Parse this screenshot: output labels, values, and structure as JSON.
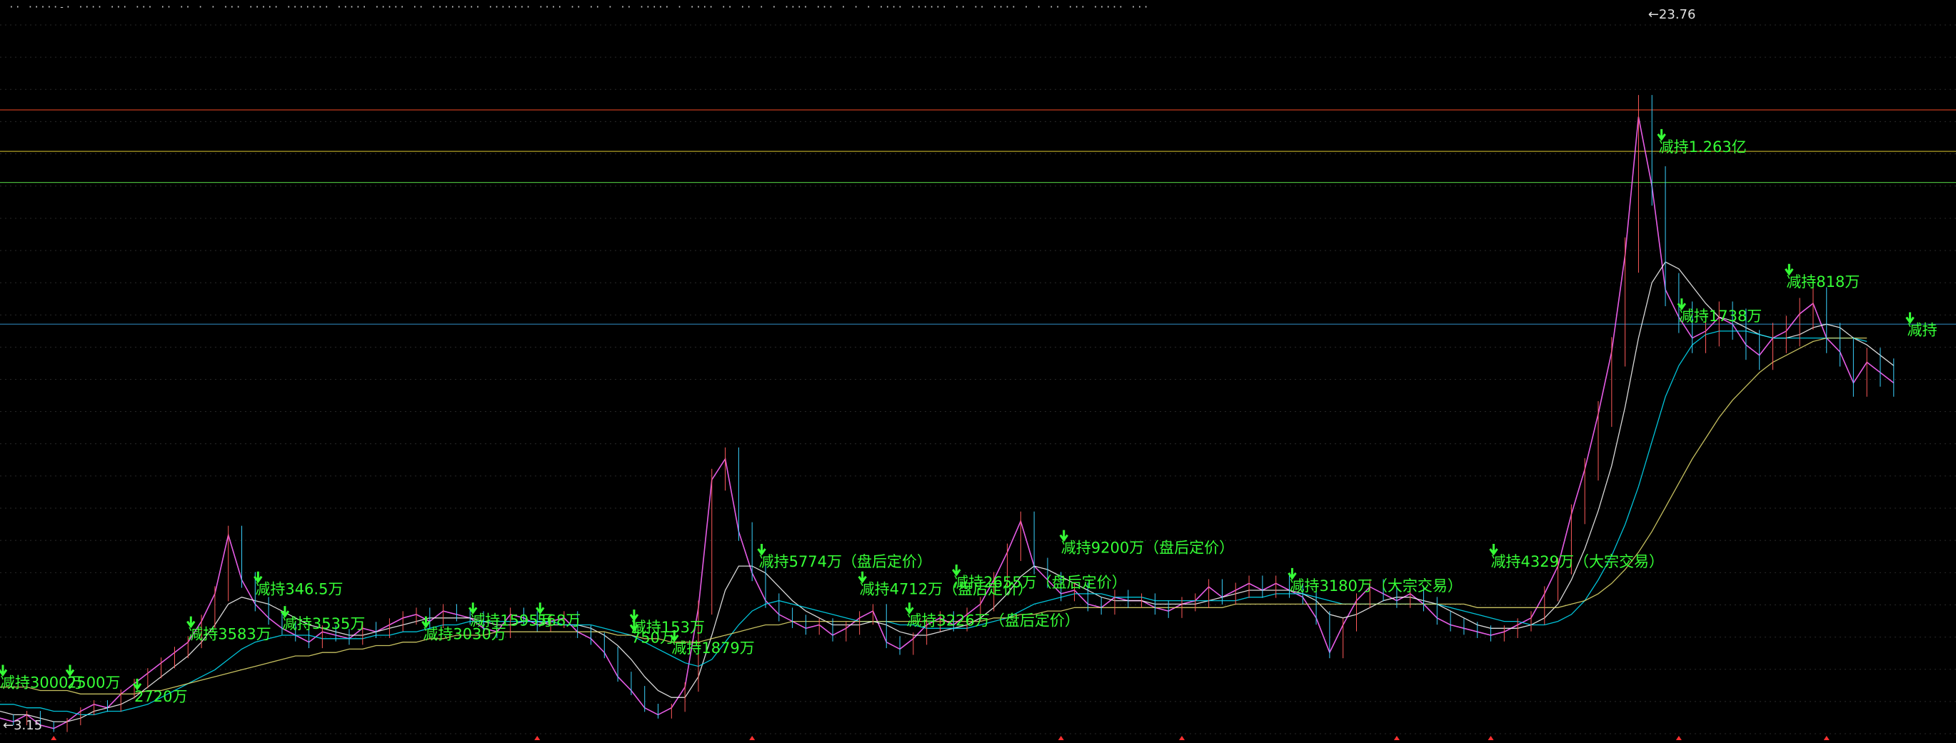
{
  "header": {
    "title": "·· ·····-· ···· ··· ··· ·· ·· · · ··· ····· ·······   ····· ·····   ··   ········ ·······  ···· ·· ·· · ·· ····· · ···· ·· ·· · · ···· ···  ·  · · ···· ······ ·· ·· ····  · ·  ·· ··· ····· ···"
  },
  "chart_data": {
    "type": "line",
    "title": "",
    "xlabel": "",
    "ylabel": "",
    "ylim": [
      3.15,
      23.76
    ],
    "grid": true,
    "x": [
      0,
      2,
      4,
      6,
      8,
      10,
      12,
      14,
      16,
      18,
      20,
      22,
      24,
      26,
      28,
      30,
      32,
      34,
      36,
      38,
      40,
      42,
      44,
      46,
      48,
      50,
      52,
      54,
      56,
      58,
      60,
      62,
      64,
      66,
      68,
      70,
      72,
      74,
      76,
      78,
      80,
      82,
      84,
      86,
      88,
      90,
      92,
      94,
      96,
      98,
      100,
      102,
      104,
      106,
      108,
      110,
      112,
      114,
      116,
      118,
      120,
      122,
      124,
      126,
      128,
      130,
      132,
      134,
      136,
      138,
      140,
      142,
      144,
      146,
      148,
      150,
      152,
      154,
      156,
      158,
      160,
      162,
      164,
      166,
      168,
      170,
      172,
      174,
      176,
      178,
      180,
      182,
      184,
      186,
      188,
      190,
      192,
      194,
      196,
      198,
      200,
      202,
      204,
      206,
      208,
      210,
      212,
      214,
      216,
      218,
      220,
      222,
      224,
      226,
      228,
      230,
      232,
      234,
      236,
      238,
      240,
      242,
      244,
      246,
      248,
      250,
      252,
      254,
      256,
      258,
      260,
      262,
      264,
      266,
      268,
      270,
      272,
      274,
      276,
      278,
      280,
      282,
      284,
      286,
      288,
      290
    ],
    "series": [
      {
        "values": [
          3.6,
          3.5,
          3.7,
          3.4,
          3.3,
          3.5,
          3.8,
          4.0,
          3.9,
          4.3,
          4.6,
          4.9,
          5.2,
          5.5,
          5.8,
          6.4,
          7.2,
          8.9,
          7.6,
          6.9,
          6.5,
          6.2,
          6.0,
          5.8,
          6.1,
          6.0,
          5.9,
          6.2,
          6.1,
          6.3,
          6.5,
          6.6,
          6.4,
          6.7,
          6.6,
          6.5,
          6.2,
          6.1,
          6.6,
          6.5,
          6.3,
          6.4,
          6.5,
          6.1,
          5.9,
          5.5,
          4.8,
          4.4,
          3.9,
          3.7,
          3.9,
          4.5,
          6.8,
          10.5,
          11.1,
          9.0,
          7.8,
          7.0,
          6.6,
          6.4,
          6.2,
          6.3,
          6.0,
          6.2,
          6.5,
          6.7,
          5.8,
          5.6,
          5.9,
          6.3,
          6.5,
          6.3,
          6.6,
          6.9,
          7.6,
          8.4,
          9.3,
          8.0,
          7.6,
          7.2,
          7.3,
          6.9,
          6.8,
          7.1,
          7.0,
          7.0,
          6.8,
          6.7,
          6.9,
          7.0,
          7.4,
          7.1,
          7.3,
          7.5,
          7.3,
          7.5,
          7.3,
          7.1,
          6.5,
          5.5,
          6.3,
          7.0,
          7.4,
          7.2,
          7.0,
          7.2,
          6.9,
          6.5,
          6.3,
          6.2,
          6.1,
          6.0,
          6.1,
          6.3,
          6.5,
          7.2,
          8.0,
          9.5,
          10.8,
          12.4,
          14.2,
          17.0,
          21.0,
          19.0,
          16.0,
          15.2,
          14.6,
          14.8,
          15.2,
          15.0,
          14.4,
          14.1,
          14.6,
          14.8,
          15.3,
          15.6,
          14.6,
          14.2,
          13.3,
          13.9,
          13.6,
          13.3
        ]
      },
      {
        "values": [
          3.8,
          3.7,
          3.7,
          3.6,
          3.5,
          3.5,
          3.6,
          3.8,
          3.9,
          4.0,
          4.2,
          4.5,
          4.8,
          5.1,
          5.4,
          5.8,
          6.3,
          6.9,
          7.1,
          7.0,
          6.9,
          6.7,
          6.5,
          6.3,
          6.2,
          6.1,
          6.0,
          6.0,
          6.1,
          6.2,
          6.3,
          6.4,
          6.5,
          6.5,
          6.5,
          6.5,
          6.4,
          6.3,
          6.3,
          6.4,
          6.4,
          6.3,
          6.3,
          6.3,
          6.2,
          6.0,
          5.7,
          5.3,
          4.8,
          4.4,
          4.2,
          4.2,
          4.8,
          6.0,
          7.3,
          8.0,
          8.0,
          7.8,
          7.4,
          7.0,
          6.7,
          6.5,
          6.3,
          6.3,
          6.3,
          6.4,
          6.3,
          6.1,
          6.0,
          6.0,
          6.1,
          6.2,
          6.3,
          6.5,
          6.8,
          7.2,
          7.7,
          8.0,
          7.9,
          7.7,
          7.5,
          7.3,
          7.1,
          7.0,
          7.0,
          7.0,
          6.9,
          6.9,
          6.9,
          6.9,
          7.0,
          7.1,
          7.2,
          7.3,
          7.3,
          7.3,
          7.3,
          7.2,
          7.0,
          6.6,
          6.5,
          6.6,
          6.8,
          7.0,
          7.1,
          7.1,
          7.0,
          6.9,
          6.7,
          6.5,
          6.3,
          6.2,
          6.2,
          6.2,
          6.3,
          6.5,
          6.9,
          7.6,
          8.5,
          9.6,
          10.9,
          12.6,
          14.6,
          16.2,
          16.8,
          16.6,
          16.1,
          15.6,
          15.2,
          15.1,
          14.9,
          14.7,
          14.6,
          14.6,
          14.7,
          14.9,
          15.0,
          14.9,
          14.6,
          14.4,
          14.1,
          13.8
        ]
      },
      {
        "values": [
          4.0,
          4.0,
          3.9,
          3.9,
          3.8,
          3.8,
          3.7,
          3.7,
          3.8,
          3.8,
          3.9,
          4.0,
          4.2,
          4.4,
          4.6,
          4.8,
          5.0,
          5.3,
          5.6,
          5.8,
          5.9,
          6.0,
          6.0,
          6.0,
          5.9,
          5.9,
          5.9,
          5.9,
          6.0,
          6.0,
          6.1,
          6.1,
          6.2,
          6.3,
          6.3,
          6.4,
          6.4,
          6.4,
          6.4,
          6.4,
          6.4,
          6.4,
          6.3,
          6.3,
          6.3,
          6.2,
          6.1,
          6.0,
          5.8,
          5.6,
          5.4,
          5.2,
          5.1,
          5.3,
          5.8,
          6.3,
          6.7,
          6.9,
          7.0,
          6.9,
          6.8,
          6.7,
          6.6,
          6.5,
          6.4,
          6.4,
          6.4,
          6.3,
          6.3,
          6.2,
          6.2,
          6.2,
          6.2,
          6.3,
          6.4,
          6.5,
          6.7,
          6.9,
          7.0,
          7.1,
          7.2,
          7.2,
          7.2,
          7.1,
          7.1,
          7.1,
          7.0,
          7.0,
          7.0,
          7.0,
          7.0,
          7.0,
          7.0,
          7.1,
          7.1,
          7.2,
          7.2,
          7.2,
          7.1,
          7.0,
          6.9,
          6.9,
          6.9,
          6.9,
          6.9,
          6.9,
          6.9,
          6.9,
          6.8,
          6.7,
          6.6,
          6.5,
          6.4,
          6.4,
          6.3,
          6.3,
          6.4,
          6.6,
          7.0,
          7.6,
          8.3,
          9.2,
          10.3,
          11.6,
          12.9,
          13.8,
          14.4,
          14.7,
          14.8,
          14.8,
          14.8,
          14.7,
          14.6,
          14.6,
          14.6,
          14.6,
          14.6,
          14.6,
          14.6,
          14.5
        ]
      },
      {
        "values": [
          4.5,
          4.5,
          4.5,
          4.4,
          4.4,
          4.4,
          4.3,
          4.3,
          4.3,
          4.3,
          4.3,
          4.4,
          4.4,
          4.5,
          4.6,
          4.7,
          4.8,
          4.9,
          5.0,
          5.1,
          5.2,
          5.3,
          5.4,
          5.4,
          5.5,
          5.5,
          5.6,
          5.6,
          5.7,
          5.7,
          5.8,
          5.8,
          5.9,
          5.9,
          6.0,
          6.0,
          6.0,
          6.1,
          6.1,
          6.1,
          6.1,
          6.1,
          6.1,
          6.1,
          6.1,
          6.1,
          6.0,
          6.0,
          5.9,
          5.9,
          5.8,
          5.8,
          5.8,
          5.9,
          6.0,
          6.1,
          6.2,
          6.3,
          6.3,
          6.4,
          6.4,
          6.4,
          6.4,
          6.4,
          6.4,
          6.4,
          6.4,
          6.4,
          6.4,
          6.4,
          6.4,
          6.4,
          6.4,
          6.4,
          6.5,
          6.5,
          6.6,
          6.6,
          6.7,
          6.7,
          6.8,
          6.8,
          6.8,
          6.8,
          6.8,
          6.8,
          6.8,
          6.8,
          6.8,
          6.8,
          6.8,
          6.8,
          6.9,
          6.9,
          6.9,
          6.9,
          6.9,
          6.9,
          6.9,
          6.9,
          6.9,
          6.9,
          6.9,
          6.9,
          6.9,
          6.9,
          6.9,
          6.9,
          6.9,
          6.9,
          6.8,
          6.8,
          6.8,
          6.8,
          6.8,
          6.8,
          6.8,
          6.9,
          7.0,
          7.2,
          7.5,
          7.9,
          8.4,
          9.0,
          9.7,
          10.4,
          11.1,
          11.7,
          12.3,
          12.8,
          13.2,
          13.6,
          13.9,
          14.1,
          14.3,
          14.5,
          14.6,
          14.6,
          14.6,
          14.6
        ]
      }
    ],
    "series_colors": [
      "#ff66ff",
      "#ffffff",
      "#00e5ff",
      "#e8e070"
    ],
    "annotations": [
      {
        "text": "减持3000万",
        "x": 0,
        "y": 4.4
      },
      {
        "text": "2500万",
        "x": 10,
        "y": 4.4
      },
      {
        "text": "2720万",
        "x": 20,
        "y": 4.0
      },
      {
        "text": "减持3583万",
        "x": 28,
        "y": 5.8
      },
      {
        "text": "减持346.5万",
        "x": 38,
        "y": 7.1
      },
      {
        "text": "减持3535万",
        "x": 42,
        "y": 6.1
      },
      {
        "text": "减持1595万",
        "x": 70,
        "y": 6.2
      },
      {
        "text": "减持3030万",
        "x": 63,
        "y": 5.8
      },
      {
        "text": "568万",
        "x": 80,
        "y": 6.2
      },
      {
        "text": "减持153万",
        "x": 94,
        "y": 6.0
      },
      {
        "text": "750万",
        "x": 94,
        "y": 5.7
      },
      {
        "text": "减持1879万",
        "x": 100,
        "y": 5.4
      },
      {
        "text": "减持5774万（盘后定价）",
        "x": 113,
        "y": 7.9
      },
      {
        "text": "减持4712万（盘后定价）",
        "x": 128,
        "y": 7.1
      },
      {
        "text": "减持2655万（盘后定价）",
        "x": 142,
        "y": 7.3
      },
      {
        "text": "减持3226万（盘后定价）",
        "x": 135,
        "y": 6.2
      },
      {
        "text": "减持9200万（盘后定价）",
        "x": 158,
        "y": 8.3
      },
      {
        "text": "减持3180万（大宗交易）",
        "x": 192,
        "y": 7.2
      },
      {
        "text": "减持4329万（大宗交易）",
        "x": 222,
        "y": 7.9
      },
      {
        "text": "减持1.263亿",
        "x": 247,
        "y": 19.9
      },
      {
        "text": "减持1738万",
        "x": 250,
        "y": 15.0
      },
      {
        "text": "减持818万",
        "x": 266,
        "y": 16.0
      },
      {
        "text": "减持",
        "x": 284,
        "y": 14.6
      }
    ],
    "extremes": [
      {
        "text": "←23.76",
        "x": 245,
        "y": 23.76
      },
      {
        "text": "←3.15",
        "x": 0,
        "y": 3.15
      }
    ],
    "horizontal_lines": [
      {
        "y": 21.2,
        "color": "#c23a1e"
      },
      {
        "y": 20.0,
        "color": "#c8b52a"
      },
      {
        "y": 19.1,
        "color": "#46b23a"
      },
      {
        "y": 15.0,
        "color": "#2a7fb0"
      }
    ],
    "event_markers": [
      8,
      80,
      112,
      158,
      176,
      208,
      222,
      250,
      272
    ]
  }
}
